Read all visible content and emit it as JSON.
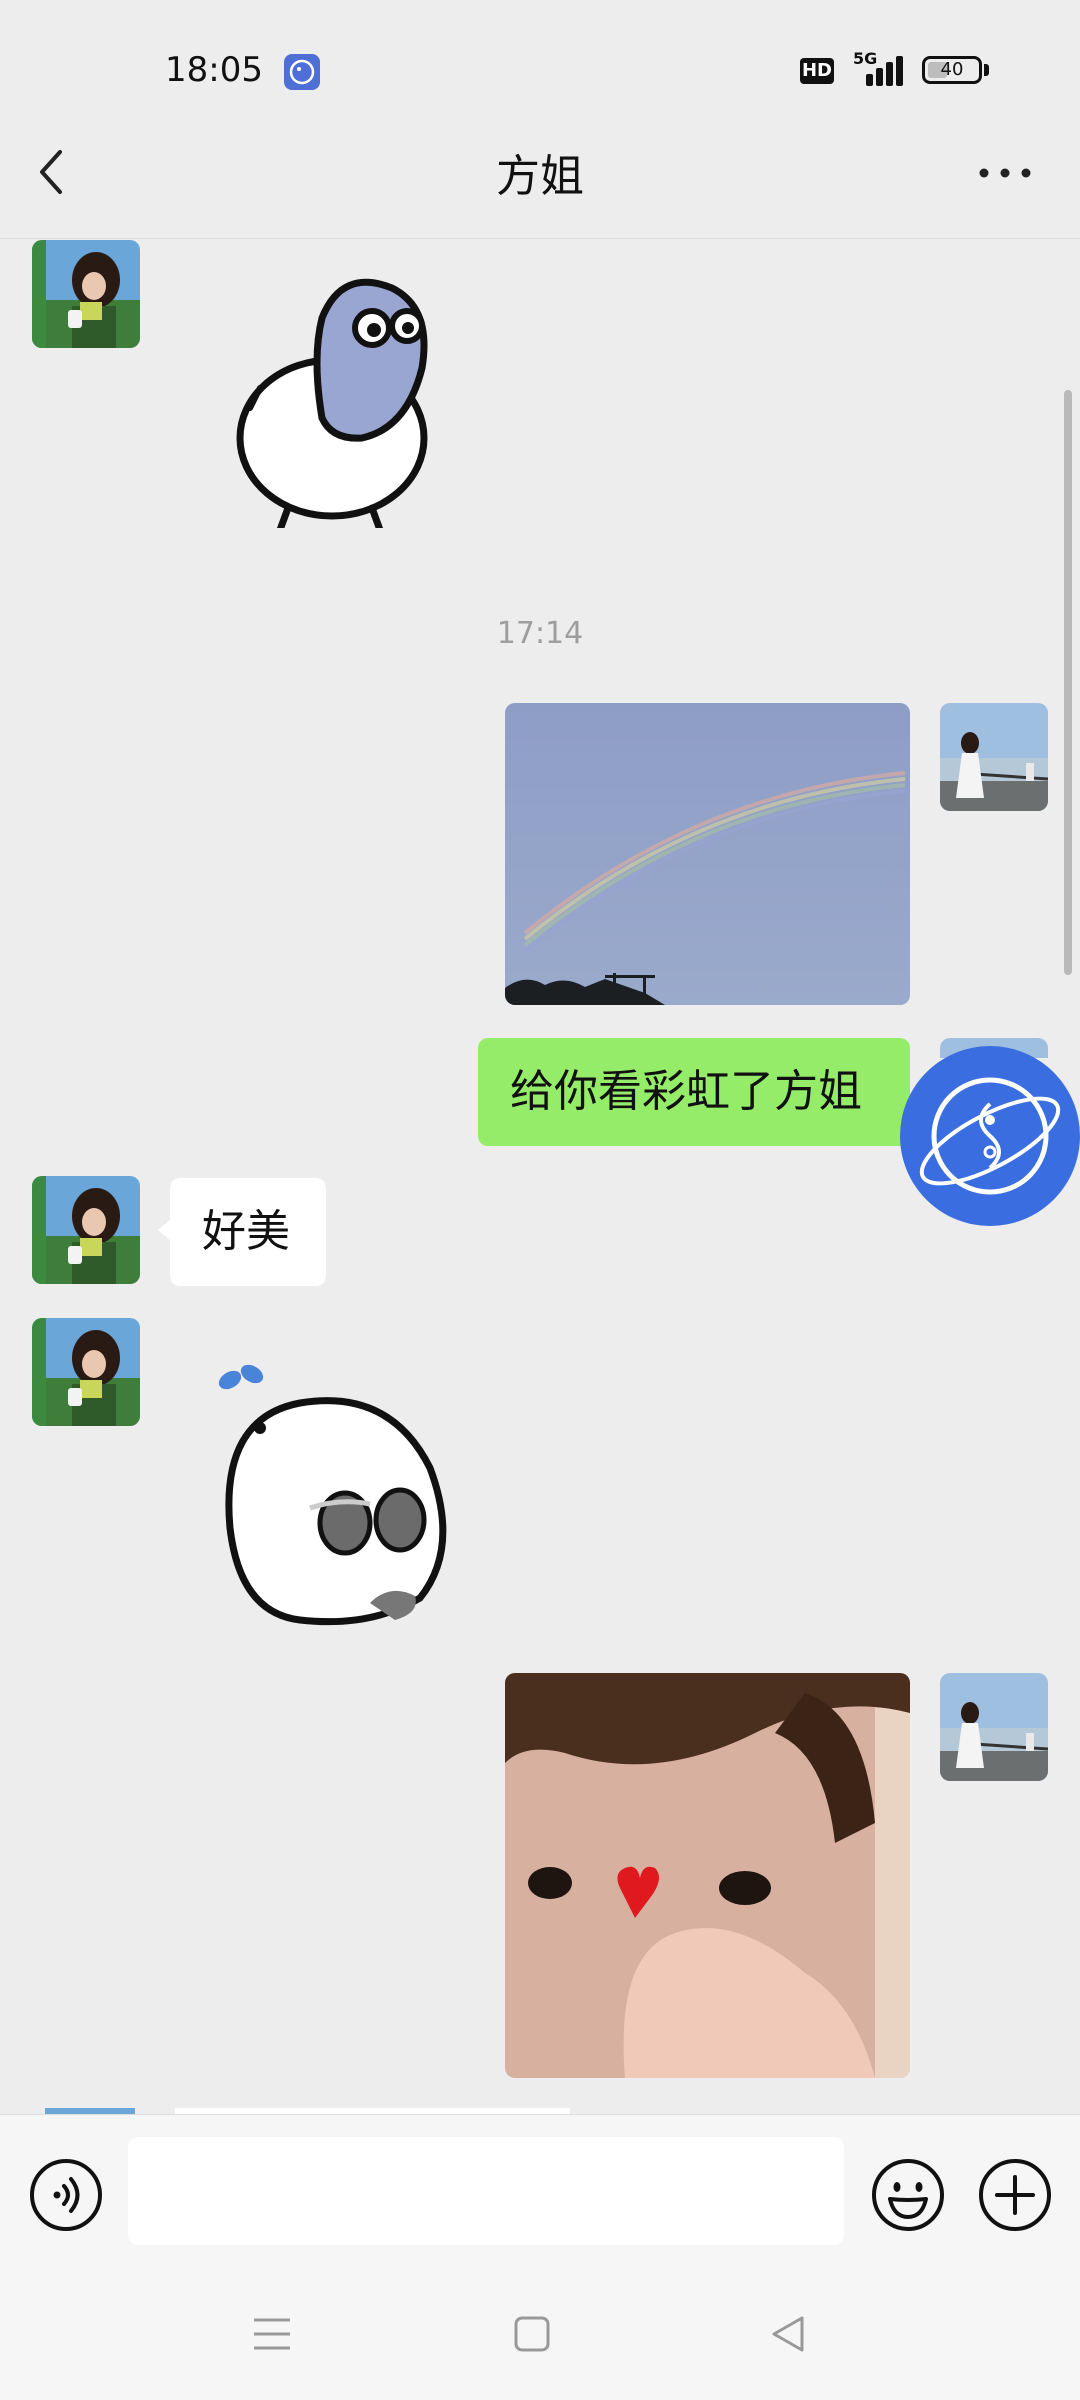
{
  "status_bar": {
    "time": "18:05",
    "network": "5G",
    "hd": "HD",
    "battery": "40",
    "battery_level": 0.4
  },
  "header": {
    "title": "方姐",
    "back_icon": "chevron-left-icon",
    "more_icon": "more-dots-icon"
  },
  "messages": [
    {
      "side": "left",
      "type": "sticker",
      "desc_icon": "bird-sticker"
    },
    {
      "type": "timestamp",
      "text": "17:14"
    },
    {
      "side": "right",
      "type": "image",
      "image": "rainbow-photo"
    },
    {
      "side": "right",
      "type": "text",
      "text": "给你看彩虹了方姐"
    },
    {
      "side": "left",
      "type": "text",
      "text": "好美"
    },
    {
      "side": "left",
      "type": "sticker",
      "desc_icon": "blob-sticker"
    },
    {
      "side": "right",
      "type": "image",
      "image": "baby-photo"
    }
  ],
  "input_bar": {
    "input_value": "",
    "voice_icon": "voice-icon",
    "emoji_icon": "emoji-icon",
    "plus_icon": "plus-icon"
  },
  "nav_bar": {
    "menu_icon": "menu-icon",
    "home_icon": "home-icon",
    "back_icon": "back-triangle-icon"
  },
  "colors": {
    "background": "#ededed",
    "green_bubble": "#95ec69",
    "white_bubble": "#ffffff",
    "widget": "#3a6ee0"
  }
}
